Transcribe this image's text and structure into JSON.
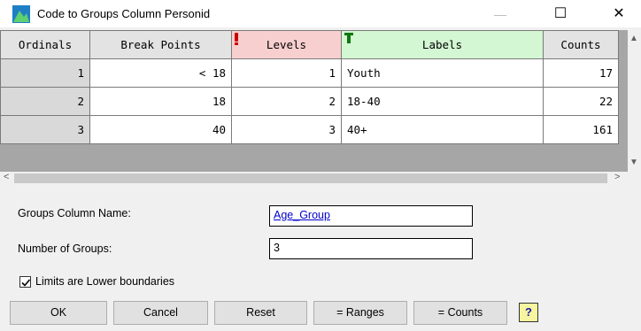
{
  "window": {
    "title": "Code to Groups Column Personid",
    "minimize_icon": "minimize-icon",
    "maximize_icon": "maximize-icon",
    "close_icon": "close-icon",
    "min_glyph": "—",
    "max_glyph": "☐",
    "close_glyph": "✕"
  },
  "grid": {
    "headers": [
      "Ordinals",
      "Break Points",
      "Levels",
      "Labels",
      "Counts"
    ],
    "rows": [
      {
        "ordinal": "1",
        "break_point": "< 18",
        "level": "1",
        "label": "Youth",
        "count": "17"
      },
      {
        "ordinal": "2",
        "break_point": "18",
        "level": "2",
        "label": "18-40",
        "count": "22"
      },
      {
        "ordinal": "3",
        "break_point": "40",
        "level": "3",
        "label": "40+",
        "count": "161"
      }
    ],
    "header_colors": {
      "levels": "#f8cfcf",
      "labels": "#d3f6d3",
      "default": "#e3e3e3"
    }
  },
  "form": {
    "groups_column_name_label": "Groups Column Name:",
    "groups_column_name_value": "Age_Group",
    "number_of_groups_label": "Number of Groups:",
    "number_of_groups_value": "3",
    "limits_checkbox_label": "Limits are Lower boundaries",
    "limits_checked": true
  },
  "buttons": {
    "ok": "OK",
    "cancel": "Cancel",
    "reset": "Reset",
    "ranges": "= Ranges",
    "counts": "= Counts",
    "help": "?"
  },
  "scroll": {
    "up": "▲",
    "down": "▼",
    "left": "<",
    "right": ">"
  }
}
